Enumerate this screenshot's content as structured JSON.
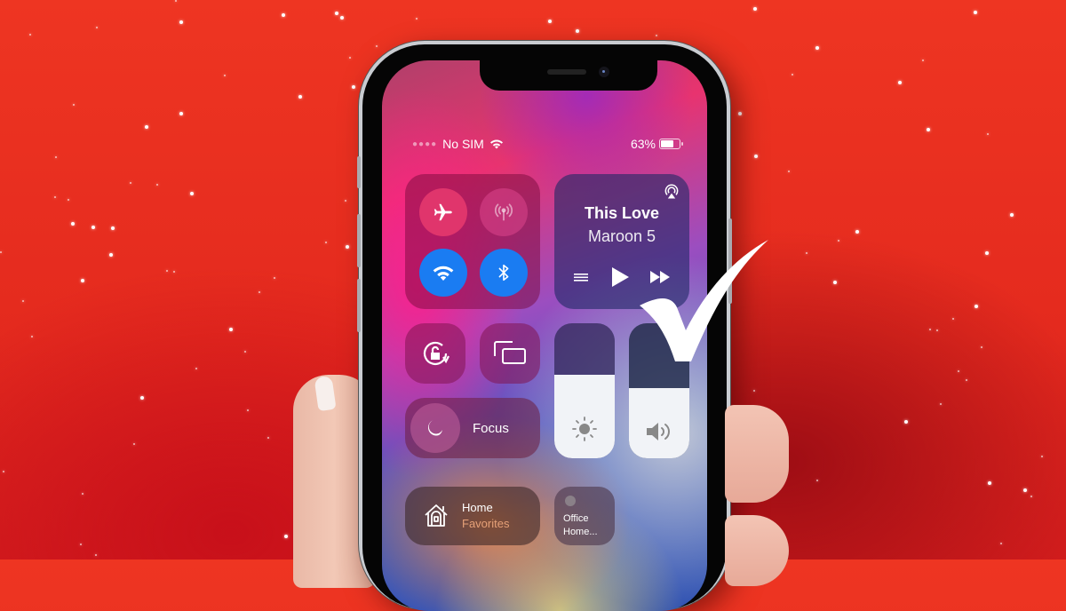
{
  "status_bar": {
    "carrier": "No SIM",
    "battery_text": "63%",
    "battery_level": 0.63,
    "wifi_icon": "wifi-icon"
  },
  "connectivity": {
    "airplane": {
      "icon": "airplane-icon",
      "state": "on"
    },
    "cellular": {
      "icon": "cellular-antenna-icon",
      "state": "disabled"
    },
    "wifi": {
      "icon": "wifi-icon",
      "state": "on"
    },
    "bluetooth": {
      "icon": "bluetooth-icon",
      "state": "on"
    }
  },
  "now_playing": {
    "title": "This Love",
    "artist": "Maroon 5",
    "controls": [
      "list-icon",
      "play-icon",
      "fast-forward-icon"
    ],
    "airplay_icon": "airplay-icon"
  },
  "toggles": {
    "orientation_lock": {
      "icon": "rotation-lock-icon"
    },
    "screen_mirroring": {
      "icon": "screen-mirroring-icon"
    }
  },
  "focus": {
    "label": "Focus",
    "icon": "moon-icon"
  },
  "sliders": {
    "brightness": {
      "level": 0.62,
      "icon": "sun-icon"
    },
    "volume": {
      "level": 0.52,
      "icon": "speaker-icon"
    }
  },
  "home": {
    "title": "Home",
    "subtitle": "Favorites",
    "icon": "home-icon"
  },
  "office": {
    "line1": "Office",
    "line2": "Home..."
  },
  "overlay": {
    "icon": "checkmark-icon"
  },
  "colors": {
    "background": "#ee3522",
    "toggle_on": "#1a7cf2",
    "airplane_on": "#e0356c"
  }
}
